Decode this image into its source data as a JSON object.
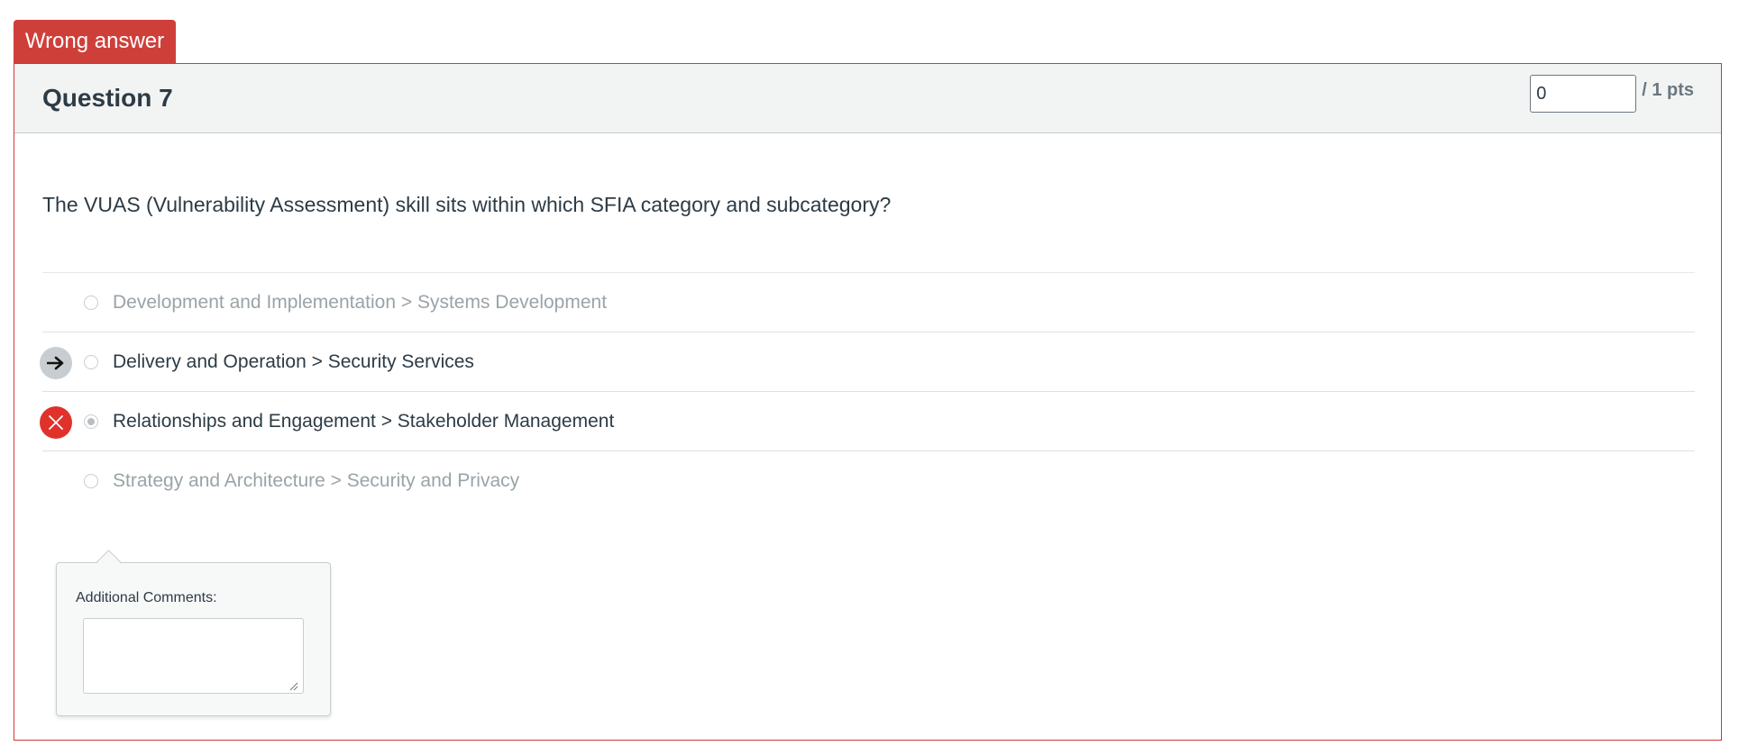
{
  "status": {
    "label": "Wrong answer",
    "color": "#cf3f3a"
  },
  "question": {
    "title": "Question 7",
    "score_value": "0",
    "points_label": "/ 1 pts",
    "text": "The VUAS (Vulnerability Assessment) skill sits within which SFIA category and subcategory?"
  },
  "answers": [
    {
      "label": "Development and Implementation > Systems Development",
      "selected": false,
      "marker": "none"
    },
    {
      "label": "Delivery and Operation > Security Services",
      "selected": false,
      "marker": "arrow-right-icon"
    },
    {
      "label": "Relationships and Engagement > Stakeholder Management",
      "selected": true,
      "marker": "close-icon"
    },
    {
      "label": "Strategy and Architecture > Security and Privacy",
      "selected": false,
      "marker": "none"
    }
  ],
  "comments": {
    "label": "Additional Comments:",
    "value": ""
  },
  "colors": {
    "border": "#d2373a",
    "wrong_marker": "#e0312b",
    "correct_marker": "#c7cdd1"
  }
}
